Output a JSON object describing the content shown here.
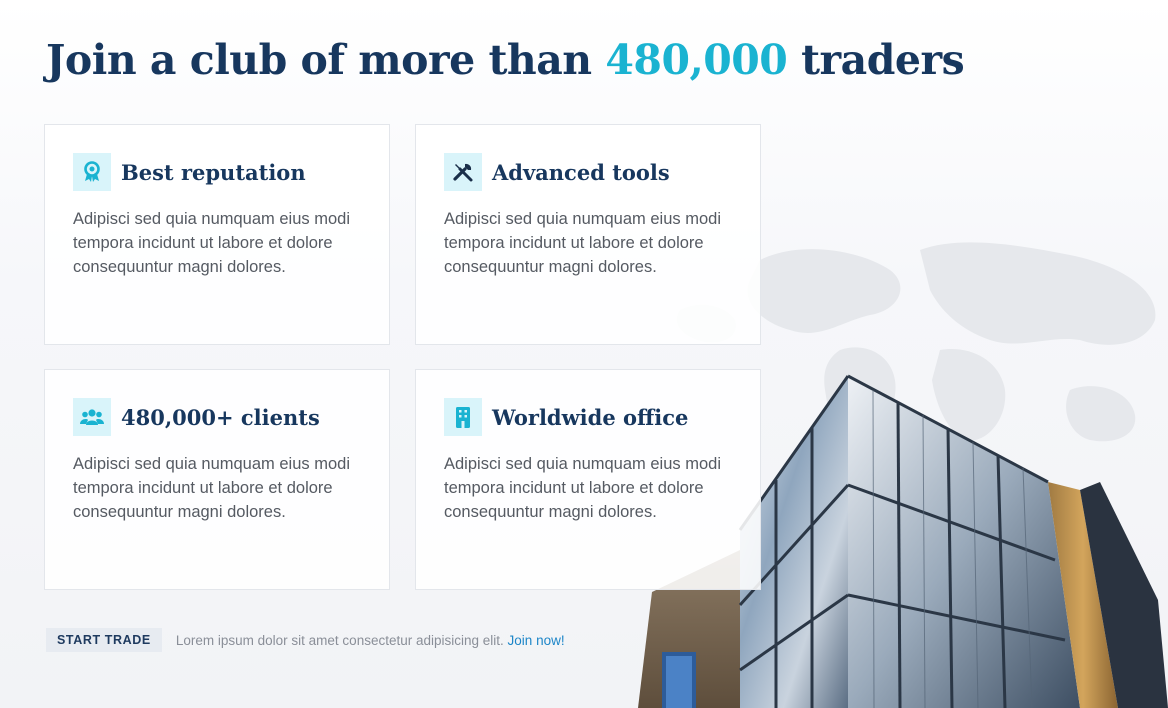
{
  "headline": {
    "before": "Join a club of more than ",
    "accent": "480,000",
    "after": " traders"
  },
  "cards": [
    {
      "icon": "award-icon",
      "title": "Best reputation",
      "text": "Adipisci sed quia numquam eius modi tempora incidunt ut labore et dolore consequuntur magni dolores."
    },
    {
      "icon": "tools-icon",
      "title": "Advanced tools",
      "text": "Adipisci sed quia numquam eius modi tempora incidunt ut labore et dolore consequuntur magni dolores."
    },
    {
      "icon": "users-icon",
      "title": "480,000+ clients",
      "text": "Adipisci sed quia numquam eius modi tempora incidunt ut labore et dolore consequuntur magni dolores."
    },
    {
      "icon": "building-icon",
      "title": "Worldwide office",
      "text": "Adipisci sed quia numquam eius modi tempora incidunt ut labore et dolore consequuntur magni dolores."
    }
  ],
  "footer": {
    "button_label": "START TRADE",
    "text": "Lorem ipsum dolor sit amet consectetur adipisicing elit.",
    "link_label": "Join now!"
  },
  "colors": {
    "heading": "#17375e",
    "accent": "#1ab3d1",
    "icon_bg": "#d9f4fa",
    "link": "#1d86c8"
  }
}
